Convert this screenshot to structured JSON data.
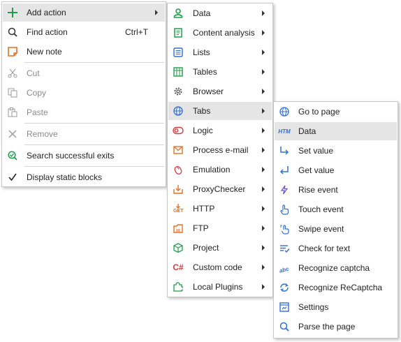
{
  "main_menu": {
    "items": [
      {
        "label": "Add action",
        "icon": "plus-icon"
      },
      {
        "label": "Find action",
        "shortcut": "Ctrl+T",
        "icon": "search-icon"
      },
      {
        "label": "New note",
        "icon": "note-icon"
      },
      {
        "label": "Cut",
        "icon": "scissors-icon",
        "disabled": true
      },
      {
        "label": "Copy",
        "icon": "copy-icon",
        "disabled": true
      },
      {
        "label": "Paste",
        "icon": "paste-icon",
        "disabled": true
      },
      {
        "label": "Remove",
        "icon": "remove-x-icon",
        "disabled": true
      },
      {
        "label": "Search successful exits",
        "icon": "search-check-icon"
      },
      {
        "label": "Display static blocks",
        "icon": "checkmark-icon"
      }
    ]
  },
  "action_menu": {
    "items": [
      {
        "label": "Data",
        "icon": "user-data-icon"
      },
      {
        "label": "Content analysis",
        "icon": "document-analysis-icon"
      },
      {
        "label": "Lists",
        "icon": "list-icon"
      },
      {
        "label": "Tables",
        "icon": "table-icon"
      },
      {
        "label": "Browser",
        "icon": "gear-icon"
      },
      {
        "label": "Tabs",
        "icon": "globe-icon"
      },
      {
        "label": "Logic",
        "icon": "toggle-icon"
      },
      {
        "label": "Process e-mail",
        "icon": "envelope-icon"
      },
      {
        "label": "Emulation",
        "icon": "mouse-icon"
      },
      {
        "label": "ProxyChecker",
        "icon": "proxy-download-icon"
      },
      {
        "label": "HTTP",
        "icon": "http-get-icon",
        "icon_text": "GET"
      },
      {
        "label": "FTP",
        "icon": "ftp-icon"
      },
      {
        "label": "Project",
        "icon": "cube-icon"
      },
      {
        "label": "Custom code",
        "icon": "csharp-icon",
        "icon_text": "C#"
      },
      {
        "label": "Local Plugins",
        "icon": "puzzle-icon"
      }
    ]
  },
  "tabs_menu": {
    "items": [
      {
        "label": "Go to page",
        "icon": "globe-icon"
      },
      {
        "label": "Data",
        "icon": "html-icon",
        "icon_text": "HTM"
      },
      {
        "label": "Set value",
        "icon": "arrow-set-icon"
      },
      {
        "label": "Get value",
        "icon": "arrow-get-icon"
      },
      {
        "label": "Rise event",
        "icon": "lightning-icon"
      },
      {
        "label": "Touch event",
        "icon": "hand-touch-icon"
      },
      {
        "label": "Swipe event",
        "icon": "hand-swipe-icon"
      },
      {
        "label": "Check for text",
        "icon": "text-check-icon"
      },
      {
        "label": "Recognize captcha",
        "icon": "captcha-icon"
      },
      {
        "label": "Recognize ReCaptcha",
        "icon": "recaptcha-icon"
      },
      {
        "label": "Settings",
        "icon": "settings-window-icon"
      },
      {
        "label": "Parse the page",
        "icon": "search-icon"
      }
    ]
  },
  "colors": {
    "highlight": "#e5e5e5",
    "green": "#1f9f4a",
    "orange": "#e86f1f",
    "blue": "#2f6fd6",
    "red": "#d9363e",
    "gray": "#9a9a9a"
  }
}
